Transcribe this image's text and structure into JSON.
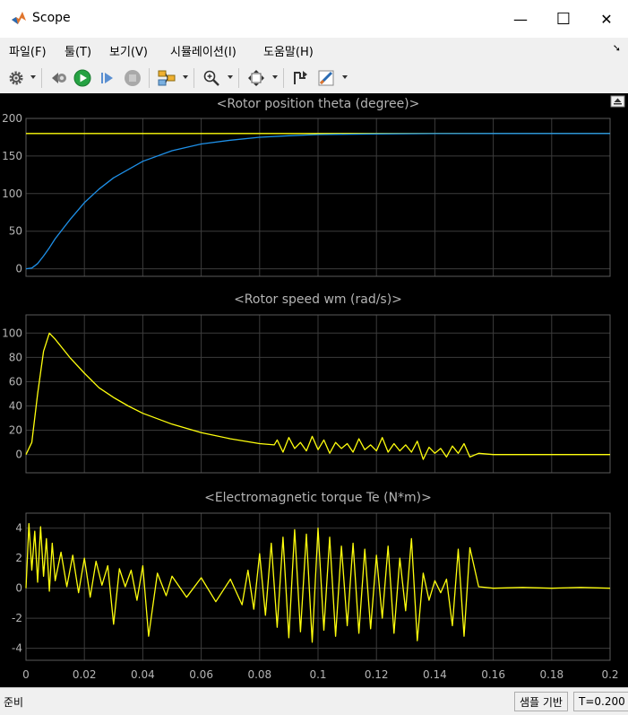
{
  "window": {
    "title": "Scope",
    "minimize": "—",
    "maximize": "☐",
    "close": "✕"
  },
  "menu": [
    {
      "label": "파일(F)"
    },
    {
      "label": "툴(T)"
    },
    {
      "label": "보기(V)"
    },
    {
      "label": "시뮬레이션(I)"
    },
    {
      "label": "도움말(H)"
    }
  ],
  "toolbar": {
    "icons": [
      "gear-icon",
      "step-back-icon",
      "run-icon",
      "step-forward-icon",
      "stop-icon",
      "signal-select-icon",
      "zoom-icon",
      "fit-to-view-icon",
      "cursor-measurement-icon",
      "style-icon"
    ]
  },
  "status": {
    "left": "준비",
    "mode": "샘플 기반",
    "time": "T=0.200"
  },
  "colors": {
    "axes_bg": "#000000",
    "grid": "#3c3c3c",
    "tick": "#b4b4b4",
    "yellow": "#ffff0d",
    "blue": "#1e90e8"
  },
  "chart_data": [
    {
      "type": "line",
      "title": "<Rotor position theta (degree)>",
      "xlim": [
        0,
        0.2
      ],
      "ylim": [
        -10,
        200
      ],
      "yticks": [
        0,
        50,
        100,
        150,
        200
      ],
      "series": [
        {
          "color": "#ffff0d",
          "x": [
            0,
            0.2
          ],
          "y": [
            180,
            180
          ]
        },
        {
          "color": "#1e90e8",
          "x": [
            0,
            0.002,
            0.004,
            0.006,
            0.008,
            0.01,
            0.015,
            0.02,
            0.025,
            0.03,
            0.04,
            0.05,
            0.06,
            0.07,
            0.08,
            0.09,
            0.1,
            0.12,
            0.14,
            0.16,
            0.18,
            0.2
          ],
          "y": [
            0,
            1,
            7,
            17,
            28,
            40,
            65,
            88,
            106,
            121,
            143,
            157,
            166,
            171,
            175,
            177,
            178.5,
            179.4,
            179.8,
            180,
            180,
            180
          ]
        }
      ]
    },
    {
      "type": "line",
      "title": "<Rotor speed wm (rad/s)>",
      "xlim": [
        0,
        0.2
      ],
      "ylim": [
        -15,
        115
      ],
      "yticks": [
        0,
        20,
        40,
        60,
        80,
        100
      ],
      "series": [
        {
          "color": "#ffff0d",
          "x": [
            0,
            0.002,
            0.004,
            0.006,
            0.008,
            0.01,
            0.015,
            0.02,
            0.025,
            0.03,
            0.035,
            0.04,
            0.05,
            0.06,
            0.07,
            0.08,
            0.085,
            0.086,
            0.088,
            0.09,
            0.092,
            0.094,
            0.096,
            0.098,
            0.1,
            0.102,
            0.104,
            0.106,
            0.108,
            0.11,
            0.112,
            0.114,
            0.116,
            0.118,
            0.12,
            0.122,
            0.124,
            0.126,
            0.128,
            0.13,
            0.132,
            0.134,
            0.136,
            0.138,
            0.14,
            0.142,
            0.144,
            0.146,
            0.148,
            0.15,
            0.152,
            0.155,
            0.16,
            0.18,
            0.2
          ],
          "y": [
            0,
            10,
            50,
            85,
            100,
            95,
            80,
            67,
            55,
            47,
            40,
            34,
            25,
            18,
            13,
            9,
            8,
            12,
            2,
            14,
            5,
            10,
            3,
            15,
            4,
            12,
            1,
            10,
            5,
            9,
            2,
            13,
            4,
            8,
            3,
            14,
            2,
            9,
            3,
            8,
            2,
            11,
            -4,
            6,
            1,
            5,
            -2,
            7,
            1,
            9,
            -2,
            1,
            0,
            0,
            0
          ]
        }
      ]
    },
    {
      "type": "line",
      "title": "<Electromagnetic torque Te (N*m)>",
      "xlim": [
        0,
        0.2
      ],
      "ylim": [
        -4.8,
        5
      ],
      "yticks": [
        -4,
        -2,
        0,
        2,
        4
      ],
      "xticks": [
        0,
        0.02,
        0.04,
        0.06,
        0.08,
        0.1,
        0.12,
        0.14,
        0.16,
        0.18,
        0.2
      ],
      "series": [
        {
          "color": "#ffff0d",
          "x": [
            0,
            0.001,
            0.002,
            0.003,
            0.004,
            0.005,
            0.006,
            0.007,
            0.008,
            0.009,
            0.01,
            0.012,
            0.014,
            0.016,
            0.018,
            0.02,
            0.022,
            0.024,
            0.026,
            0.028,
            0.03,
            0.032,
            0.034,
            0.036,
            0.038,
            0.04,
            0.042,
            0.045,
            0.048,
            0.05,
            0.055,
            0.06,
            0.065,
            0.07,
            0.074,
            0.076,
            0.078,
            0.08,
            0.082,
            0.084,
            0.086,
            0.088,
            0.09,
            0.092,
            0.094,
            0.096,
            0.098,
            0.1,
            0.102,
            0.104,
            0.106,
            0.108,
            0.11,
            0.112,
            0.114,
            0.116,
            0.118,
            0.12,
            0.122,
            0.124,
            0.126,
            0.128,
            0.13,
            0.132,
            0.134,
            0.136,
            0.138,
            0.14,
            0.142,
            0.144,
            0.146,
            0.148,
            0.15,
            0.152,
            0.155,
            0.16,
            0.17,
            0.18,
            0.19,
            0.2
          ],
          "y": [
            0,
            4.3,
            1.2,
            3.8,
            0.4,
            4.1,
            0.8,
            3.3,
            -0.2,
            3.0,
            0.5,
            2.4,
            0.1,
            2.2,
            -0.3,
            2.0,
            -0.6,
            1.8,
            0.2,
            1.5,
            -2.4,
            1.3,
            0.1,
            1.2,
            -0.8,
            1.5,
            -3.2,
            1.0,
            -0.5,
            0.8,
            -0.6,
            0.7,
            -0.9,
            0.6,
            -1.1,
            1.2,
            -1.4,
            2.3,
            -1.8,
            3.0,
            -2.6,
            3.4,
            -3.3,
            3.9,
            -2.9,
            3.6,
            -3.6,
            4.0,
            -2.8,
            3.4,
            -3.2,
            2.8,
            -2.5,
            3.0,
            -3.0,
            2.6,
            -2.7,
            2.2,
            -2.0,
            2.8,
            -3.0,
            2.0,
            -1.5,
            3.3,
            -3.5,
            1.0,
            -0.8,
            0.5,
            -0.3,
            0.6,
            -2.5,
            2.6,
            -3.2,
            2.7,
            0.1,
            0,
            0.05,
            0,
            0.05,
            0
          ]
        }
      ]
    }
  ]
}
